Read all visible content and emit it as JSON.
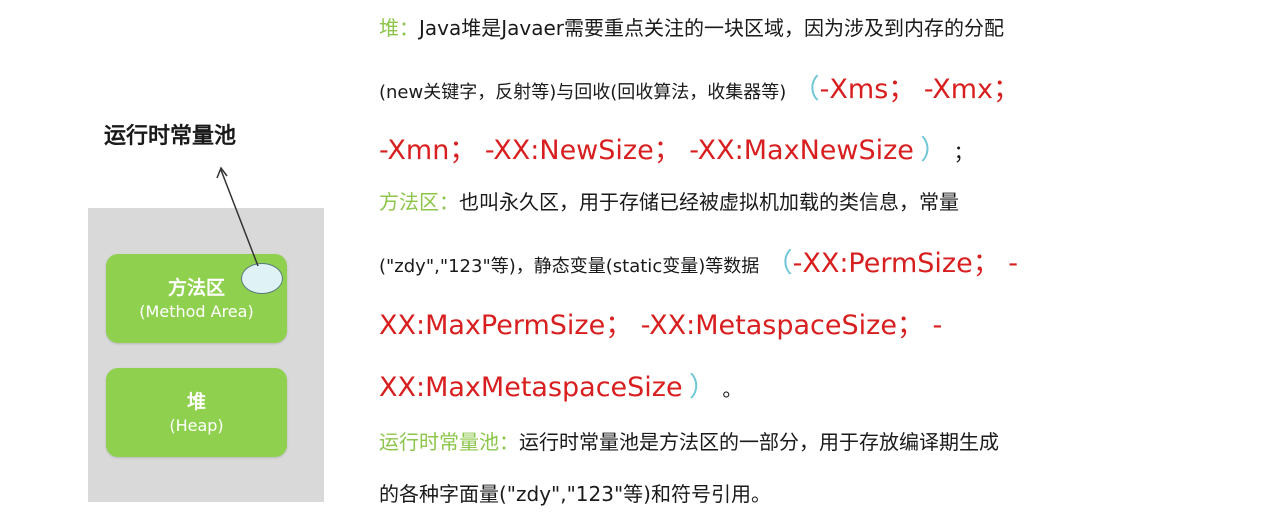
{
  "diagram": {
    "method_area": {
      "title": "方法区",
      "subtitle": "(Method Area)"
    },
    "heap": {
      "title": "堆",
      "subtitle": "(Heap)"
    },
    "pool_label": "运行时常量池"
  },
  "text": {
    "heap_head": "堆：",
    "heap_line1": "Java堆是Javaer需要重点关注的一块区域，因为涉及到内存的分配",
    "heap_line2": "(new关键字，反射等)与回收(回收算法，收集器等)",
    "heap_paren_open": "（",
    "heap_params_a": "-Xms；  -Xmx；",
    "heap_params_b": "-Xmn；  -XX:NewSize；  -XX:MaxNewSize",
    "heap_paren_close": "）",
    "heap_end": "；",
    "method_head": "方法区：",
    "method_line1": "也叫永久区，用于存储已经被虚拟机加载的类信息，常量",
    "method_line2": "(\"zdy\",\"123\"等)，静态变量(static变量)等数据",
    "method_paren_open": "（",
    "method_params_a": "-XX:PermSize；  -",
    "method_params_b": "XX:MaxPermSize；  -XX:MetaspaceSize；  -",
    "method_params_c": "XX:MaxMetaspaceSize",
    "method_paren_close": "）",
    "method_end": "。",
    "pool_head": "运行时常量池：",
    "pool_line1": "运行时常量池是方法区的一部分，用于存放编译期生成",
    "pool_line2": "的各种字面量(\"zdy\",\"123\"等)和符号引用。"
  }
}
